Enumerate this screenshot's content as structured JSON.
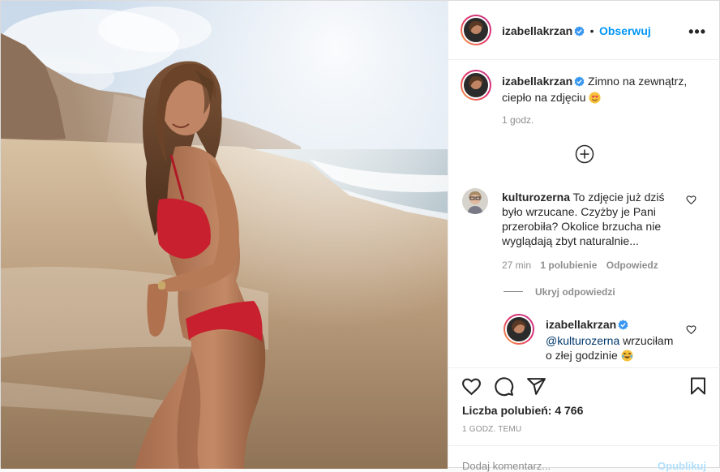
{
  "post": {
    "username": "izabellakrzan",
    "follow_label": "Obserwuj",
    "more_label": "•••"
  },
  "caption": {
    "username": "izabellakrzan",
    "text_line1": "Zimno na zewnątrz,",
    "text_line2": "ciepło na zdjęciu",
    "time": "1 godz."
  },
  "comment": {
    "username": "kulturozerna",
    "line1": "To zdjęcie już dziś",
    "line2": "było wrzucane. Czyżby je Pani",
    "line3": "przerobiła? Okolice brzucha nie",
    "line4": "wyglądają zbyt naturalnie...",
    "time": "27 min",
    "likes": "1 polubienie",
    "reply_label": "Odpowiedz",
    "hide_replies": "Ukryj odpowiedzi"
  },
  "reply": {
    "username": "izabellakrzan",
    "mention": "@kulturozerna",
    "text_line1": " wrzuciłam",
    "text_line2": "o złej godzinie"
  },
  "footer": {
    "likes_label": "Liczba polubień: 4 766",
    "time": "1 GODZ. TEMU",
    "comment_placeholder": "Dodaj komentarz...",
    "post_button": "Opublikuj"
  },
  "colors": {
    "accent": "#0095f6",
    "verified": "#3897f0",
    "bikini": "#c8202e"
  },
  "icons": [
    "verified-icon",
    "more-options-icon",
    "load-more-comments-icon",
    "heart-icon",
    "comment-icon",
    "share-icon",
    "bookmark-icon",
    "laughing-emoji-icon",
    "heart-eyes-emoji-icon"
  ]
}
